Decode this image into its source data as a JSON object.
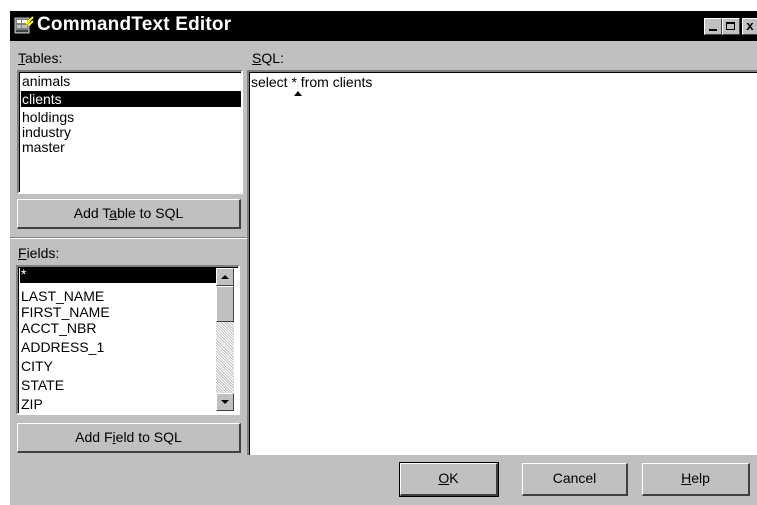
{
  "window": {
    "title": "CommandText Editor",
    "app_icon": "database-icon",
    "controls": {
      "minimize_icon": "minimize-icon",
      "maximize_icon": "maximize-icon",
      "close_label": "x"
    }
  },
  "tables": {
    "label_accel": "T",
    "label_rest": "ables:",
    "items": [
      {
        "label": "animals"
      },
      {
        "label": "clients",
        "selected": true
      },
      {
        "label": "holdings"
      },
      {
        "label": "industry"
      },
      {
        "label": "master"
      }
    ],
    "button": {
      "before": "Add T",
      "accel": "a",
      "after": "ble to SQL"
    }
  },
  "fields": {
    "label_accel": "F",
    "label_rest": "ields:",
    "items": [
      {
        "label": "*",
        "selected": true
      },
      {
        "label": "LAST_NAME"
      },
      {
        "label": "FIRST_NAME"
      },
      {
        "label": "ACCT_NBR"
      },
      {
        "label": "ADDRESS_1"
      },
      {
        "label": "CITY"
      },
      {
        "label": "STATE"
      },
      {
        "label": "ZIP"
      }
    ],
    "button": {
      "before": "Add F",
      "accel": "i",
      "after": "eld to SQL"
    }
  },
  "sql": {
    "label_accel": "S",
    "label_rest": "QL:",
    "text": "select * from clients"
  },
  "footer": {
    "ok": {
      "accel": "O",
      "rest": "K"
    },
    "cancel": "Cancel",
    "help": {
      "accel": "H",
      "rest": "elp"
    }
  },
  "colors": {
    "face": "#c0c0c0",
    "selection": "#000000",
    "titlebar": "#000000"
  }
}
